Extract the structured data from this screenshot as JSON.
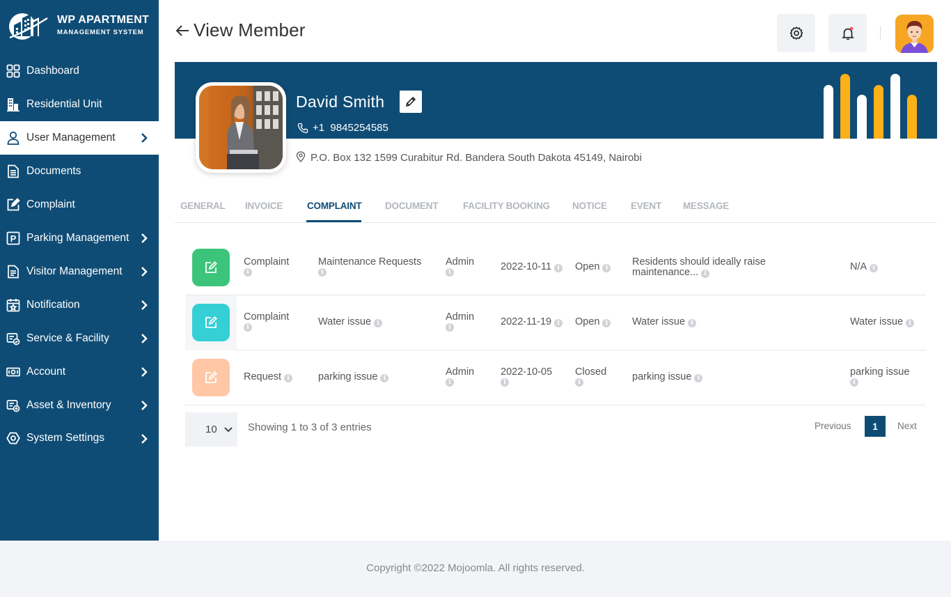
{
  "app": {
    "brand_line1": "WP APARTMENT",
    "brand_line2": "MANAGEMENT SYSTEM"
  },
  "sidebar": {
    "items": [
      {
        "label": "Dashboard",
        "icon": "dashboard-grid-icon",
        "has_chevron": false
      },
      {
        "label": "Residential Unit",
        "icon": "building-icon",
        "has_chevron": false
      },
      {
        "label": "User Management",
        "icon": "user-icon",
        "has_chevron": true,
        "active": true
      },
      {
        "label": "Documents",
        "icon": "document-icon",
        "has_chevron": false
      },
      {
        "label": "Complaint",
        "icon": "edit-square-icon",
        "has_chevron": false
      },
      {
        "label": "Parking Management",
        "icon": "parking-icon",
        "has_chevron": true
      },
      {
        "label": "Visitor Management",
        "icon": "visitor-list-icon",
        "has_chevron": true
      },
      {
        "label": "Notification",
        "icon": "calendar-star-icon",
        "has_chevron": true
      },
      {
        "label": "Service & Facility",
        "icon": "service-icon",
        "has_chevron": true
      },
      {
        "label": "Account",
        "icon": "money-icon",
        "has_chevron": true
      },
      {
        "label": "Asset & Inventory",
        "icon": "asset-icon",
        "has_chevron": true
      },
      {
        "label": "System Settings",
        "icon": "settings-eye-icon",
        "has_chevron": true
      }
    ]
  },
  "header": {
    "title": "View Member",
    "settings_icon": "gear-icon",
    "notification_icon": "bell-icon"
  },
  "member": {
    "name": "David Smith",
    "phone": "+1  9845254585",
    "address": "P.O. Box 132 1599 Curabitur Rd. Bandera South Dakota 45149, Nairobi"
  },
  "colors": {
    "primary": "#0f4c75",
    "accent_yellow": "#fbb117",
    "green": "#3cc57a",
    "teal": "#35cfd6",
    "peach": "#ffc7a6"
  },
  "tabs": [
    {
      "label": "GENERAL",
      "active": false
    },
    {
      "label": "INVOICE",
      "active": false
    },
    {
      "label": "COMPLAINT",
      "active": true
    },
    {
      "label": "DOCUMENT",
      "active": false
    },
    {
      "label": "FACILITY BOOKING",
      "active": false
    },
    {
      "label": "NOTICE",
      "active": false
    },
    {
      "label": "EVENT",
      "active": false
    },
    {
      "label": "MESSAGE",
      "active": false
    }
  ],
  "complaints": [
    {
      "type": "Complaint",
      "category": "Maintenance Requests",
      "by": "Admin",
      "date": "2022-10-11",
      "status": "Open",
      "description": "Residents should ideally raise maintenance...",
      "resolution": "N/A",
      "color": "#3cc57a"
    },
    {
      "type": "Complaint",
      "category": "Water issue",
      "by": "Admin",
      "date": "2022-11-19",
      "status": "Open",
      "description": "Water issue",
      "resolution": "Water issue",
      "color": "#35cfd6"
    },
    {
      "type": "Request",
      "category": "parking issue",
      "by": "Admin",
      "date": "2022-10-05",
      "status": "Closed",
      "description": "parking issue",
      "resolution": "parking issue",
      "color": "#ffc7a6"
    }
  ],
  "table_footer": {
    "page_size": "10",
    "showing": "Showing 1 to 3 of 3 entries",
    "previous": "Previous",
    "current_page": "1",
    "next": "Next"
  },
  "footer": {
    "copyright": "Copyright ©2022 Mojoomla. All rights reserved."
  }
}
